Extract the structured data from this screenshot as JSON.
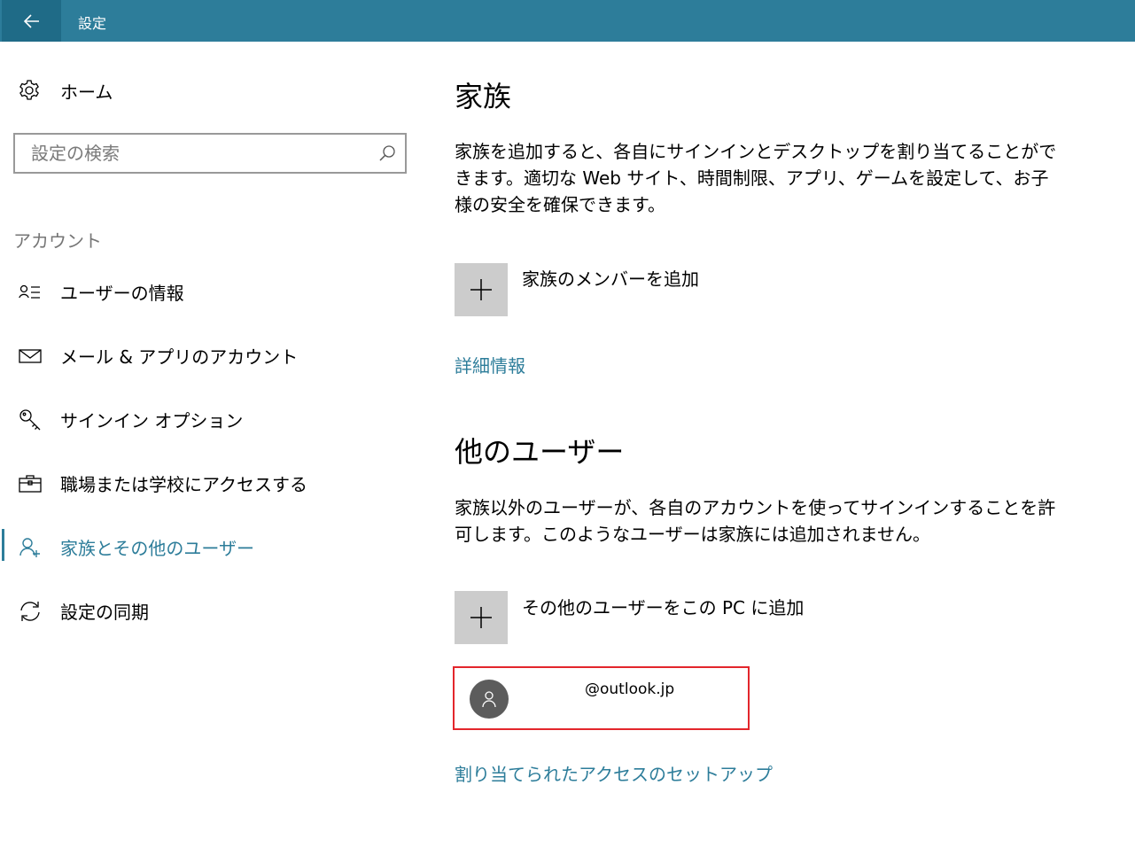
{
  "window": {
    "title": "設定"
  },
  "sidebar": {
    "home_label": "ホーム",
    "search_placeholder": "設定の検索",
    "section_label": "アカウント",
    "items": [
      {
        "label": "ユーザーの情報",
        "icon": "user-info-icon"
      },
      {
        "label": "メール & アプリのアカウント",
        "icon": "mail-icon"
      },
      {
        "label": "サインイン オプション",
        "icon": "key-icon"
      },
      {
        "label": "職場または学校にアクセスする",
        "icon": "briefcase-icon"
      },
      {
        "label": "家族とその他のユーザー",
        "icon": "family-user-icon",
        "active": true
      },
      {
        "label": "設定の同期",
        "icon": "sync-icon"
      }
    ]
  },
  "main": {
    "family": {
      "heading": "家族",
      "description": "家族を追加すると、各自にサインインとデスクトップを割り当てることができます。適切な Web サイト、時間制限、アプリ、ゲームを設定して、お子様の安全を確保できます。",
      "add_label": "家族のメンバーを追加",
      "link": "詳細情報"
    },
    "other_users": {
      "heading": "他のユーザー",
      "description": "家族以外のユーザーが、各自のアカウントを使ってサインインすることを許可します。このようなユーザーは家族には追加されません。",
      "add_label": "その他のユーザーをこの PC に追加",
      "user_email": "@outlook.jp",
      "link": "割り当てられたアクセスのセットアップ"
    }
  },
  "colors": {
    "accent": "#2d7d9a",
    "titlebar": "#2d7d9a",
    "highlight_border": "#e3262c",
    "tile": "#cccccc"
  }
}
